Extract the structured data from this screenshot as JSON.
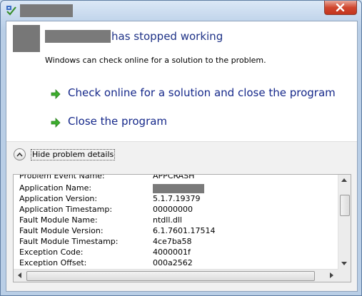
{
  "window": {
    "title_redacted": true,
    "close_icon": "close-icon",
    "app_icon": "error-report-icon"
  },
  "header": {
    "app_name_redacted": true,
    "heading": "has stopped working",
    "subtext": "Windows can check online for a solution to the problem."
  },
  "commands": [
    {
      "label": "Check online for a solution and close the program",
      "icon": "green-arrow-icon"
    },
    {
      "label": "Close the program",
      "icon": "green-arrow-icon"
    }
  ],
  "details_toggle": {
    "label": "Hide problem details",
    "icon": "chevron-up-icon"
  },
  "details": [
    {
      "key": "Problem Event Name:",
      "value": "APPCRASH"
    },
    {
      "key": "Application Name:",
      "value": "",
      "redacted": true
    },
    {
      "key": "Application Version:",
      "value": "5.1.7.19379"
    },
    {
      "key": "Application Timestamp:",
      "value": "00000000"
    },
    {
      "key": "Fault Module Name:",
      "value": "ntdll.dll"
    },
    {
      "key": "Fault Module Version:",
      "value": "6.1.7601.17514"
    },
    {
      "key": "Fault Module Timestamp:",
      "value": "4ce7ba58"
    },
    {
      "key": "Exception Code:",
      "value": "4000001f"
    },
    {
      "key": "Exception Offset:",
      "value": "000a2562"
    }
  ],
  "colors": {
    "heading": "#1e3287",
    "command_text": "#15288a",
    "arrow": "#3cae2c",
    "close_button": "#c3351e"
  }
}
